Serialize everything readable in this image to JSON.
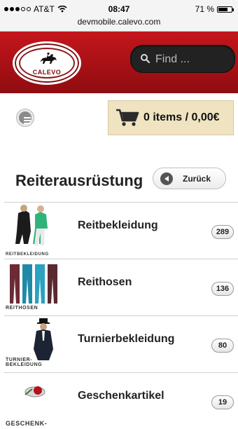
{
  "status_bar": {
    "carrier": "AT&T",
    "time": "08:47",
    "battery": "71 %",
    "battery_level": 0.71,
    "url": "devmobile.calevo.com"
  },
  "header": {
    "logo_text": "CALEVO",
    "search_placeholder": "Find ..."
  },
  "toolbar": {
    "cart_label": "0 items / 0,00€"
  },
  "page": {
    "title": "Reiterausrüstung",
    "back_label": "Zurück"
  },
  "categories": [
    {
      "name": "Reitbekleidung",
      "count": "289",
      "thumb_caption": "REITBEKLEIDUNG"
    },
    {
      "name": "Reithosen",
      "count": "136",
      "thumb_caption": "REITHOSEN"
    },
    {
      "name": "Turnierbekleidung",
      "count": "80",
      "thumb_caption": "TURNIER-BEKLEIDUNG"
    },
    {
      "name": "Geschenkartikel",
      "count": "19",
      "thumb_caption": "GESCHENK-"
    }
  ],
  "colors": {
    "header_red": "#c4161c",
    "cart_bg": "#efe3c1"
  }
}
